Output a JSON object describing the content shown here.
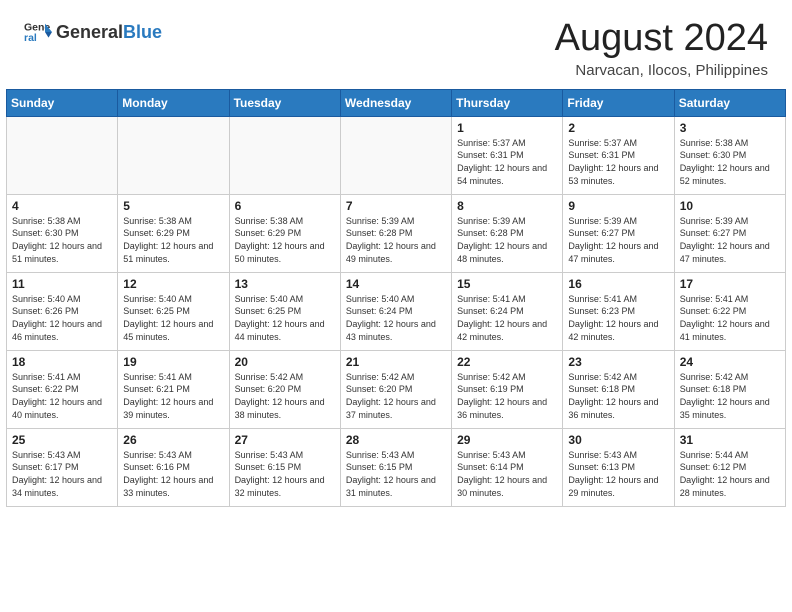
{
  "header": {
    "logo_general": "General",
    "logo_blue": "Blue",
    "month_year": "August 2024",
    "location": "Narvacan, Ilocos, Philippines"
  },
  "weekdays": [
    "Sunday",
    "Monday",
    "Tuesday",
    "Wednesday",
    "Thursday",
    "Friday",
    "Saturday"
  ],
  "weeks": [
    [
      {
        "day": "",
        "info": ""
      },
      {
        "day": "",
        "info": ""
      },
      {
        "day": "",
        "info": ""
      },
      {
        "day": "",
        "info": ""
      },
      {
        "day": "1",
        "info": "Sunrise: 5:37 AM\nSunset: 6:31 PM\nDaylight: 12 hours and 54 minutes."
      },
      {
        "day": "2",
        "info": "Sunrise: 5:37 AM\nSunset: 6:31 PM\nDaylight: 12 hours and 53 minutes."
      },
      {
        "day": "3",
        "info": "Sunrise: 5:38 AM\nSunset: 6:30 PM\nDaylight: 12 hours and 52 minutes."
      }
    ],
    [
      {
        "day": "4",
        "info": "Sunrise: 5:38 AM\nSunset: 6:30 PM\nDaylight: 12 hours and 51 minutes."
      },
      {
        "day": "5",
        "info": "Sunrise: 5:38 AM\nSunset: 6:29 PM\nDaylight: 12 hours and 51 minutes."
      },
      {
        "day": "6",
        "info": "Sunrise: 5:38 AM\nSunset: 6:29 PM\nDaylight: 12 hours and 50 minutes."
      },
      {
        "day": "7",
        "info": "Sunrise: 5:39 AM\nSunset: 6:28 PM\nDaylight: 12 hours and 49 minutes."
      },
      {
        "day": "8",
        "info": "Sunrise: 5:39 AM\nSunset: 6:28 PM\nDaylight: 12 hours and 48 minutes."
      },
      {
        "day": "9",
        "info": "Sunrise: 5:39 AM\nSunset: 6:27 PM\nDaylight: 12 hours and 47 minutes."
      },
      {
        "day": "10",
        "info": "Sunrise: 5:39 AM\nSunset: 6:27 PM\nDaylight: 12 hours and 47 minutes."
      }
    ],
    [
      {
        "day": "11",
        "info": "Sunrise: 5:40 AM\nSunset: 6:26 PM\nDaylight: 12 hours and 46 minutes."
      },
      {
        "day": "12",
        "info": "Sunrise: 5:40 AM\nSunset: 6:25 PM\nDaylight: 12 hours and 45 minutes."
      },
      {
        "day": "13",
        "info": "Sunrise: 5:40 AM\nSunset: 6:25 PM\nDaylight: 12 hours and 44 minutes."
      },
      {
        "day": "14",
        "info": "Sunrise: 5:40 AM\nSunset: 6:24 PM\nDaylight: 12 hours and 43 minutes."
      },
      {
        "day": "15",
        "info": "Sunrise: 5:41 AM\nSunset: 6:24 PM\nDaylight: 12 hours and 42 minutes."
      },
      {
        "day": "16",
        "info": "Sunrise: 5:41 AM\nSunset: 6:23 PM\nDaylight: 12 hours and 42 minutes."
      },
      {
        "day": "17",
        "info": "Sunrise: 5:41 AM\nSunset: 6:22 PM\nDaylight: 12 hours and 41 minutes."
      }
    ],
    [
      {
        "day": "18",
        "info": "Sunrise: 5:41 AM\nSunset: 6:22 PM\nDaylight: 12 hours and 40 minutes."
      },
      {
        "day": "19",
        "info": "Sunrise: 5:41 AM\nSunset: 6:21 PM\nDaylight: 12 hours and 39 minutes."
      },
      {
        "day": "20",
        "info": "Sunrise: 5:42 AM\nSunset: 6:20 PM\nDaylight: 12 hours and 38 minutes."
      },
      {
        "day": "21",
        "info": "Sunrise: 5:42 AM\nSunset: 6:20 PM\nDaylight: 12 hours and 37 minutes."
      },
      {
        "day": "22",
        "info": "Sunrise: 5:42 AM\nSunset: 6:19 PM\nDaylight: 12 hours and 36 minutes."
      },
      {
        "day": "23",
        "info": "Sunrise: 5:42 AM\nSunset: 6:18 PM\nDaylight: 12 hours and 36 minutes."
      },
      {
        "day": "24",
        "info": "Sunrise: 5:42 AM\nSunset: 6:18 PM\nDaylight: 12 hours and 35 minutes."
      }
    ],
    [
      {
        "day": "25",
        "info": "Sunrise: 5:43 AM\nSunset: 6:17 PM\nDaylight: 12 hours and 34 minutes."
      },
      {
        "day": "26",
        "info": "Sunrise: 5:43 AM\nSunset: 6:16 PM\nDaylight: 12 hours and 33 minutes."
      },
      {
        "day": "27",
        "info": "Sunrise: 5:43 AM\nSunset: 6:15 PM\nDaylight: 12 hours and 32 minutes."
      },
      {
        "day": "28",
        "info": "Sunrise: 5:43 AM\nSunset: 6:15 PM\nDaylight: 12 hours and 31 minutes."
      },
      {
        "day": "29",
        "info": "Sunrise: 5:43 AM\nSunset: 6:14 PM\nDaylight: 12 hours and 30 minutes."
      },
      {
        "day": "30",
        "info": "Sunrise: 5:43 AM\nSunset: 6:13 PM\nDaylight: 12 hours and 29 minutes."
      },
      {
        "day": "31",
        "info": "Sunrise: 5:44 AM\nSunset: 6:12 PM\nDaylight: 12 hours and 28 minutes."
      }
    ]
  ]
}
